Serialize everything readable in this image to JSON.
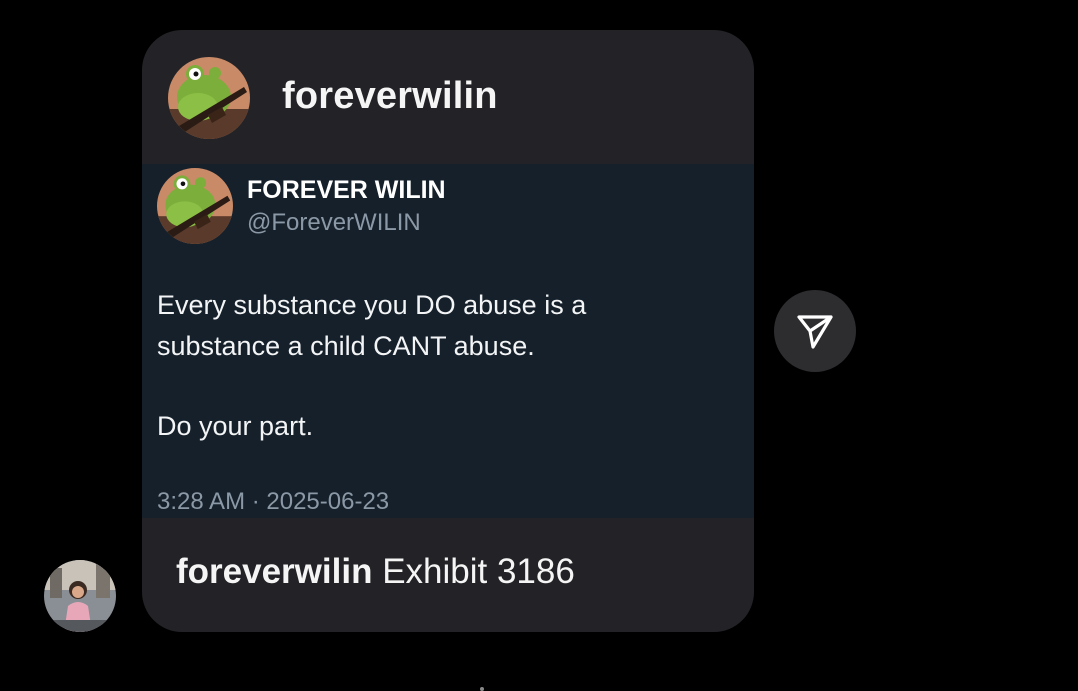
{
  "shared_post": {
    "header": {
      "username": "foreverwilin",
      "avatar_icon": "frog-avatar"
    },
    "tweet": {
      "avatar_icon": "frog-avatar",
      "display_name": "FOREVER WILIN",
      "handle": "@ForeverWILIN",
      "text_line_1": "Every substance you DO abuse is a",
      "text_line_2": "substance a child CANT abuse.",
      "text_line_3": "Do your part.",
      "timestamp": "3:28 AM · 2025-06-23"
    },
    "caption": {
      "username": "foreverwilin",
      "text": "Exhibit 3186"
    }
  },
  "share_button": {
    "icon": "send-icon"
  },
  "sender": {
    "avatar_icon": "user-avatar"
  },
  "colors": {
    "background": "#000000",
    "card": "#232327",
    "tweet_bg": "#15202b",
    "secondary_text": "#8b98a5",
    "share_button_bg": "#2d2d30"
  }
}
